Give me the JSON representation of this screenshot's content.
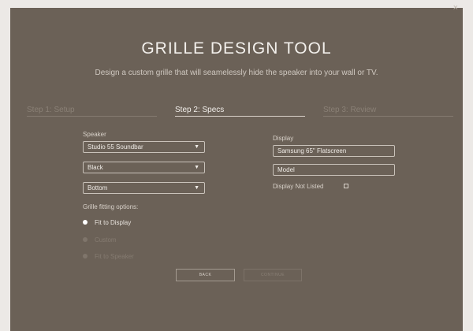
{
  "header": {
    "title": "GRILLE DESIGN TOOL",
    "subtitle": "Design a custom grille that will seamelessly hide the speaker into your wall or TV.",
    "close_glyph": "×"
  },
  "steps": [
    {
      "label": "Step 1: Setup",
      "state": "completed"
    },
    {
      "label": "Step 2: Specs",
      "state": "active"
    },
    {
      "label": "Step 3: Review",
      "state": "upcoming"
    }
  ],
  "speaker": {
    "label": "Speaker",
    "model": "Studio 55 Soundbar",
    "color": "Black",
    "position": "Bottom"
  },
  "display": {
    "label": "Display",
    "name": "Samsung 65\" Flatscreen",
    "model_placeholder": "Model",
    "not_listed_label": "Display Not Listed",
    "not_listed_checked": false
  },
  "fitting": {
    "label": "Grille fitting options:",
    "options": [
      {
        "label": "Fit to Display",
        "selected": true,
        "enabled": true
      },
      {
        "label": "Custom",
        "selected": false,
        "enabled": false
      },
      {
        "label": "Fit to Speaker",
        "selected": false,
        "enabled": false
      }
    ]
  },
  "buttons": {
    "back": "BACK",
    "continue": "CONTINUE"
  },
  "colors": {
    "panel": "#6b6157",
    "background": "#ece9e6",
    "text": "#e8e3dd"
  },
  "icons": {
    "caret": "chevron-down-icon",
    "close": "close-icon"
  }
}
